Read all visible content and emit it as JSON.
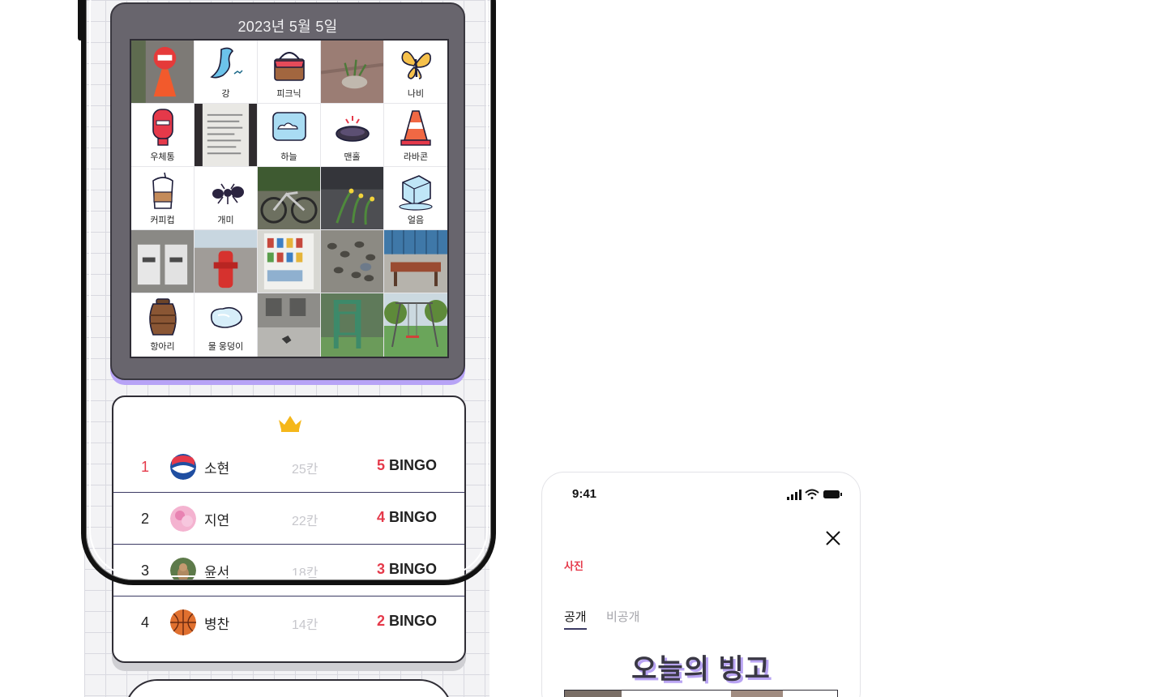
{
  "bingo": {
    "date": "2023년 5월 5일",
    "cells": [
      {
        "type": "photo",
        "icon": "parking-sign-photo"
      },
      {
        "type": "icon",
        "icon": "river-icon",
        "label": "강"
      },
      {
        "type": "icon",
        "icon": "picnic-basket-icon",
        "label": "피크닉"
      },
      {
        "type": "photo",
        "icon": "plant-pot-photo"
      },
      {
        "type": "icon",
        "icon": "butterfly-icon",
        "label": "나비"
      },
      {
        "type": "icon",
        "icon": "mailbox-icon",
        "label": "우체통"
      },
      {
        "type": "photo",
        "icon": "receipt-photo"
      },
      {
        "type": "icon",
        "icon": "sky-icon",
        "label": "하늘"
      },
      {
        "type": "icon",
        "icon": "manhole-icon",
        "label": "맨홀"
      },
      {
        "type": "icon",
        "icon": "traffic-cone-icon",
        "label": "라바콘"
      },
      {
        "type": "icon",
        "icon": "coffee-cup-icon",
        "label": "커피컵"
      },
      {
        "type": "icon",
        "icon": "ant-icon",
        "label": "개미"
      },
      {
        "type": "photo",
        "icon": "bicycle-photo"
      },
      {
        "type": "photo",
        "icon": "flowers-photo"
      },
      {
        "type": "icon",
        "icon": "ice-icon",
        "label": "얼음"
      },
      {
        "type": "photo",
        "icon": "trash-bins-photo"
      },
      {
        "type": "photo",
        "icon": "fire-hydrant-photo"
      },
      {
        "type": "photo",
        "icon": "vending-machine-photo"
      },
      {
        "type": "photo",
        "icon": "pigeons-photo"
      },
      {
        "type": "photo",
        "icon": "bench-photo"
      },
      {
        "type": "icon",
        "icon": "jar-icon",
        "label": "항아리"
      },
      {
        "type": "icon",
        "icon": "puddle-icon",
        "label": "물 웅덩이"
      },
      {
        "type": "photo",
        "icon": "building-wall-photo"
      },
      {
        "type": "photo",
        "icon": "playground-photo"
      },
      {
        "type": "photo",
        "icon": "swing-photo"
      }
    ]
  },
  "ranking": {
    "crown_icon": "crown-icon",
    "rows": [
      {
        "rank": "1",
        "name": "소현",
        "count": "25칸",
        "bingo_num": "5",
        "bingo_text": " BINGO",
        "avatar": "pepsi-avatar"
      },
      {
        "rank": "2",
        "name": "지연",
        "count": "22칸",
        "bingo_num": "4",
        "bingo_text": " BINGO",
        "avatar": "pink-avatar"
      },
      {
        "rank": "3",
        "name": "윤서",
        "count": "18칸",
        "bingo_num": "3",
        "bingo_text": " BINGO",
        "avatar": "animal-avatar"
      },
      {
        "rank": "4",
        "name": "병찬",
        "count": "14칸",
        "bingo_num": "2",
        "bingo_text": " BINGO",
        "avatar": "basketball-avatar"
      }
    ]
  },
  "modal": {
    "time": "9:41",
    "section": "사진",
    "tabs": {
      "public": "공개",
      "private": "비공개"
    },
    "title": "오늘의 빙고"
  },
  "colors": {
    "accent_red": "#e5394a",
    "purple_shadow": "#b7a3f6",
    "card_gray": "#68656d",
    "navy_line": "#3b3a63"
  }
}
